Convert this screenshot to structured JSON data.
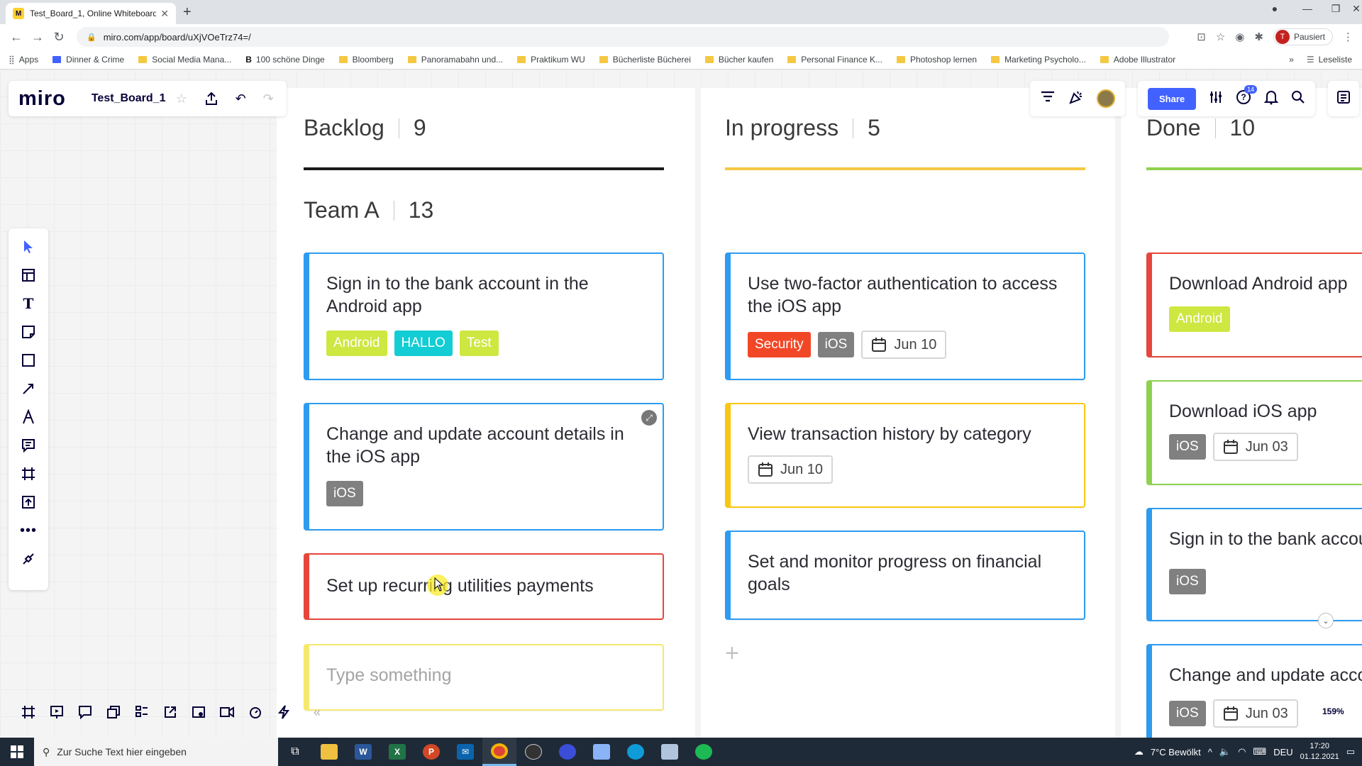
{
  "browser": {
    "tab_title": "Test_Board_1, Online Whiteboard",
    "url": "miro.com/app/board/uXjVOeTrz74=/",
    "profile_label": "Pausiert",
    "profile_initial": "T",
    "bookmarks": [
      "Apps",
      "Dinner & Crime",
      "Social Media Mana...",
      "100 schöne Dinge",
      "Bloomberg",
      "Panoramabahn und...",
      "Praktikum WU",
      "Bücherliste Bücherei",
      "Bücher kaufen",
      "Personal Finance K...",
      "Photoshop lernen",
      "Marketing Psycholo...",
      "Adobe Illustrator"
    ],
    "reading_list": "Leseliste"
  },
  "miro": {
    "logo": "miro",
    "board_name": "Test_Board_1",
    "share_label": "Share",
    "notif_badge": "14",
    "zoom": "159%"
  },
  "columns": [
    {
      "name": "Backlog",
      "count": "9",
      "color": "#1a1a1a"
    },
    {
      "name": "In progress",
      "count": "5",
      "color": "#f5c842"
    },
    {
      "name": "Done",
      "count": "10",
      "color": "#8fd14f"
    }
  ],
  "swimlane": {
    "name": "Team A",
    "count": "13"
  },
  "cards": {
    "backlog": [
      {
        "title": "Sign in to the bank account in the Android app",
        "tags": [
          "Android",
          "HALLO",
          "Test"
        ]
      },
      {
        "title": "Change and update account details in the iOS app",
        "tags": [
          "iOS"
        ]
      },
      {
        "title": "Set up recurring utilities payments"
      },
      {
        "placeholder": "Type something"
      }
    ],
    "progress": [
      {
        "title": "Use two-factor authentication to access the iOS app",
        "tags": [
          "Security",
          "iOS"
        ],
        "date": "Jun 10"
      },
      {
        "title": "View transaction history by category",
        "date": "Jun 10"
      },
      {
        "title": "Set and monitor progress on financial goals"
      }
    ],
    "done": [
      {
        "title": "Download Android app",
        "tags": [
          "Android"
        ]
      },
      {
        "title": "Download iOS app",
        "tags": [
          "iOS"
        ],
        "date": "Jun 03"
      },
      {
        "title": "Sign in to the bank account",
        "tags": [
          "iOS"
        ]
      },
      {
        "title": "Change and update account details in the iOS app",
        "tags": [
          "iOS"
        ],
        "date": "Jun 03"
      }
    ]
  },
  "colors": {
    "blue": "#2d9bf0",
    "yellow": "#fac710",
    "red": "#e6463c",
    "green": "#8fd14f",
    "android": "#cee741",
    "hallo": "#12cdd4",
    "test": "#cee741",
    "ios": "#808080",
    "security": "#f24726"
  },
  "taskbar": {
    "search_placeholder": "Zur Suche Text hier eingeben",
    "weather": "7°C Bewölkt",
    "language": "DEU",
    "time": "17:20",
    "date": "01.12.2021"
  }
}
